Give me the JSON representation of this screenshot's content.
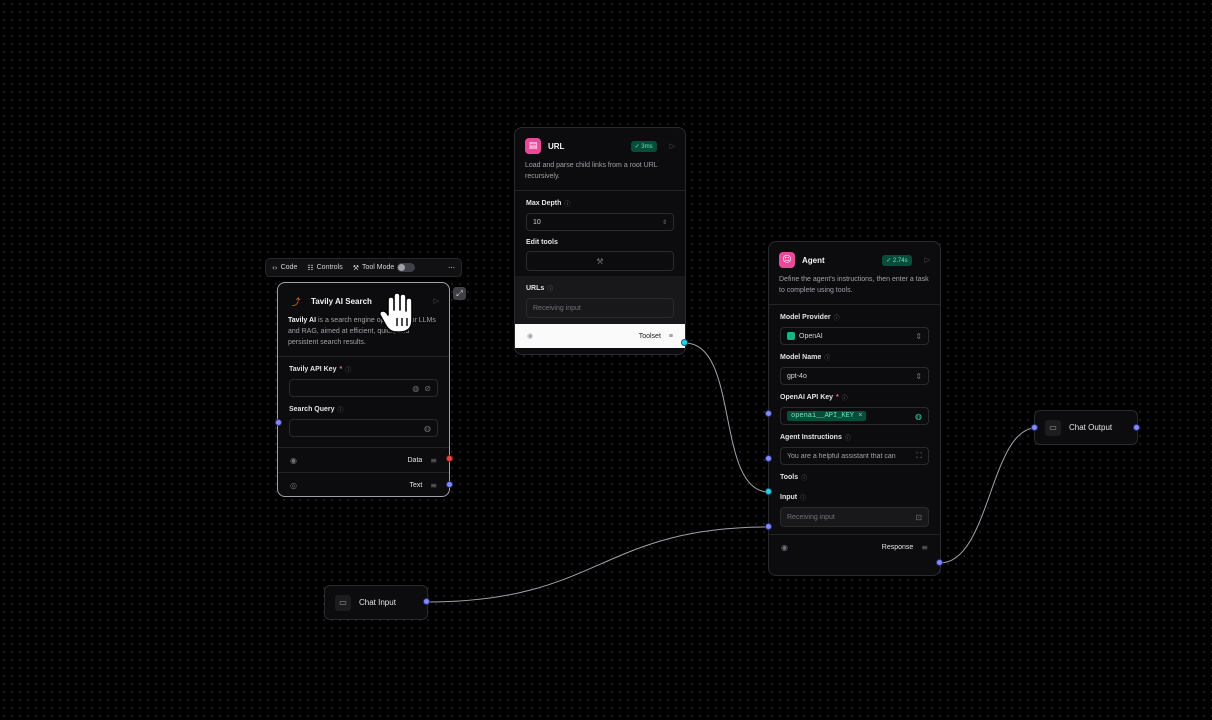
{
  "toolbar": {
    "code_label": "Code",
    "controls_label": "Controls",
    "tool_mode_label": "Tool Mode"
  },
  "tavily": {
    "title": "Tavily AI Search",
    "desc_bold": "Tavily AI",
    "desc_rest": " is a search engine optimized for LLMs and RAG, aimed at efficient, quick, and persistent search results.",
    "api_key_label": "Tavily API Key",
    "search_query_label": "Search Query",
    "output_data": "Data",
    "output_text": "Text"
  },
  "url_node": {
    "title": "URL",
    "badge": "3ms",
    "desc": "Load and parse child links from a root URL recursively.",
    "max_depth_label": "Max Depth",
    "max_depth_value": "10",
    "edit_tools_label": "Edit tools",
    "urls_label": "URLs",
    "urls_placeholder": "Receiving input",
    "output_toolset": "Toolset"
  },
  "agent": {
    "title": "Agent",
    "badge": "2.74s",
    "desc": "Define the agent's instructions, then enter a task to complete using tools.",
    "model_provider_label": "Model Provider",
    "model_provider_value": "OpenAI",
    "model_name_label": "Model Name",
    "model_name_value": "gpt-4o",
    "api_key_label": "OpenAI API Key",
    "api_key_value": "openai__API_KEY",
    "instructions_label": "Agent Instructions",
    "instructions_value": "You are a helpful assistant that can",
    "tools_label": "Tools",
    "input_label": "Input",
    "input_placeholder": "Receiving input",
    "output_response": "Response"
  },
  "chat_input": {
    "label": "Chat Input"
  },
  "chat_output": {
    "label": "Chat Output"
  },
  "colors": {
    "accent_pink": "#ec4899",
    "handle_indigo": "#818cf8",
    "handle_cyan": "#22d3ee",
    "success_badge": "#064e3b"
  }
}
